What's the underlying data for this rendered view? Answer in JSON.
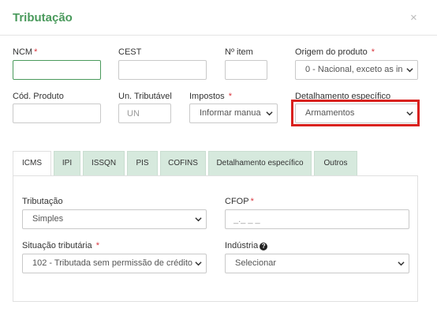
{
  "modal": {
    "title": "Tributação",
    "close_glyph": "×"
  },
  "form": {
    "ncm": {
      "label": "NCM",
      "required": "*",
      "value": ""
    },
    "cest": {
      "label": "CEST",
      "value": ""
    },
    "n_item": {
      "label": "Nº item",
      "value": ""
    },
    "origem": {
      "label": "Origem do produto",
      "required": "*",
      "selected": "0 - Nacional, exceto as in"
    },
    "cod_produto": {
      "label": "Cód. Produto",
      "value": ""
    },
    "un_tributavel": {
      "label": "Un. Tributável",
      "placeholder": "UN"
    },
    "impostos": {
      "label": "Impostos",
      "required": "*",
      "selected": "Informar manua"
    },
    "detalhamento": {
      "label": "Detalhamento específico",
      "selected": "Armamentos"
    }
  },
  "tabs": [
    {
      "label": "ICMS",
      "active": true
    },
    {
      "label": "IPI"
    },
    {
      "label": "ISSQN"
    },
    {
      "label": "PIS"
    },
    {
      "label": "COFINS"
    },
    {
      "label": "Detalhamento específico"
    },
    {
      "label": "Outros"
    }
  ],
  "icms": {
    "tributacao": {
      "label": "Tributação",
      "selected": "Simples"
    },
    "cfop": {
      "label": "CFOP",
      "required": "*",
      "placeholder": "_._ _ _"
    },
    "situacao": {
      "label": "Situação tributária",
      "required": "*",
      "selected": "102 - Tributada sem permissão de crédito"
    },
    "industria": {
      "label": "Indústria",
      "help_glyph": "?",
      "selected": "Selecionar"
    }
  },
  "colors": {
    "accent": "#4a9a5c",
    "tab_bg": "#d6e9dd",
    "highlight": "#d9211e",
    "required": "#d9363e"
  },
  "icons": [
    "close-icon",
    "chevron-down-icon",
    "help-icon"
  ]
}
